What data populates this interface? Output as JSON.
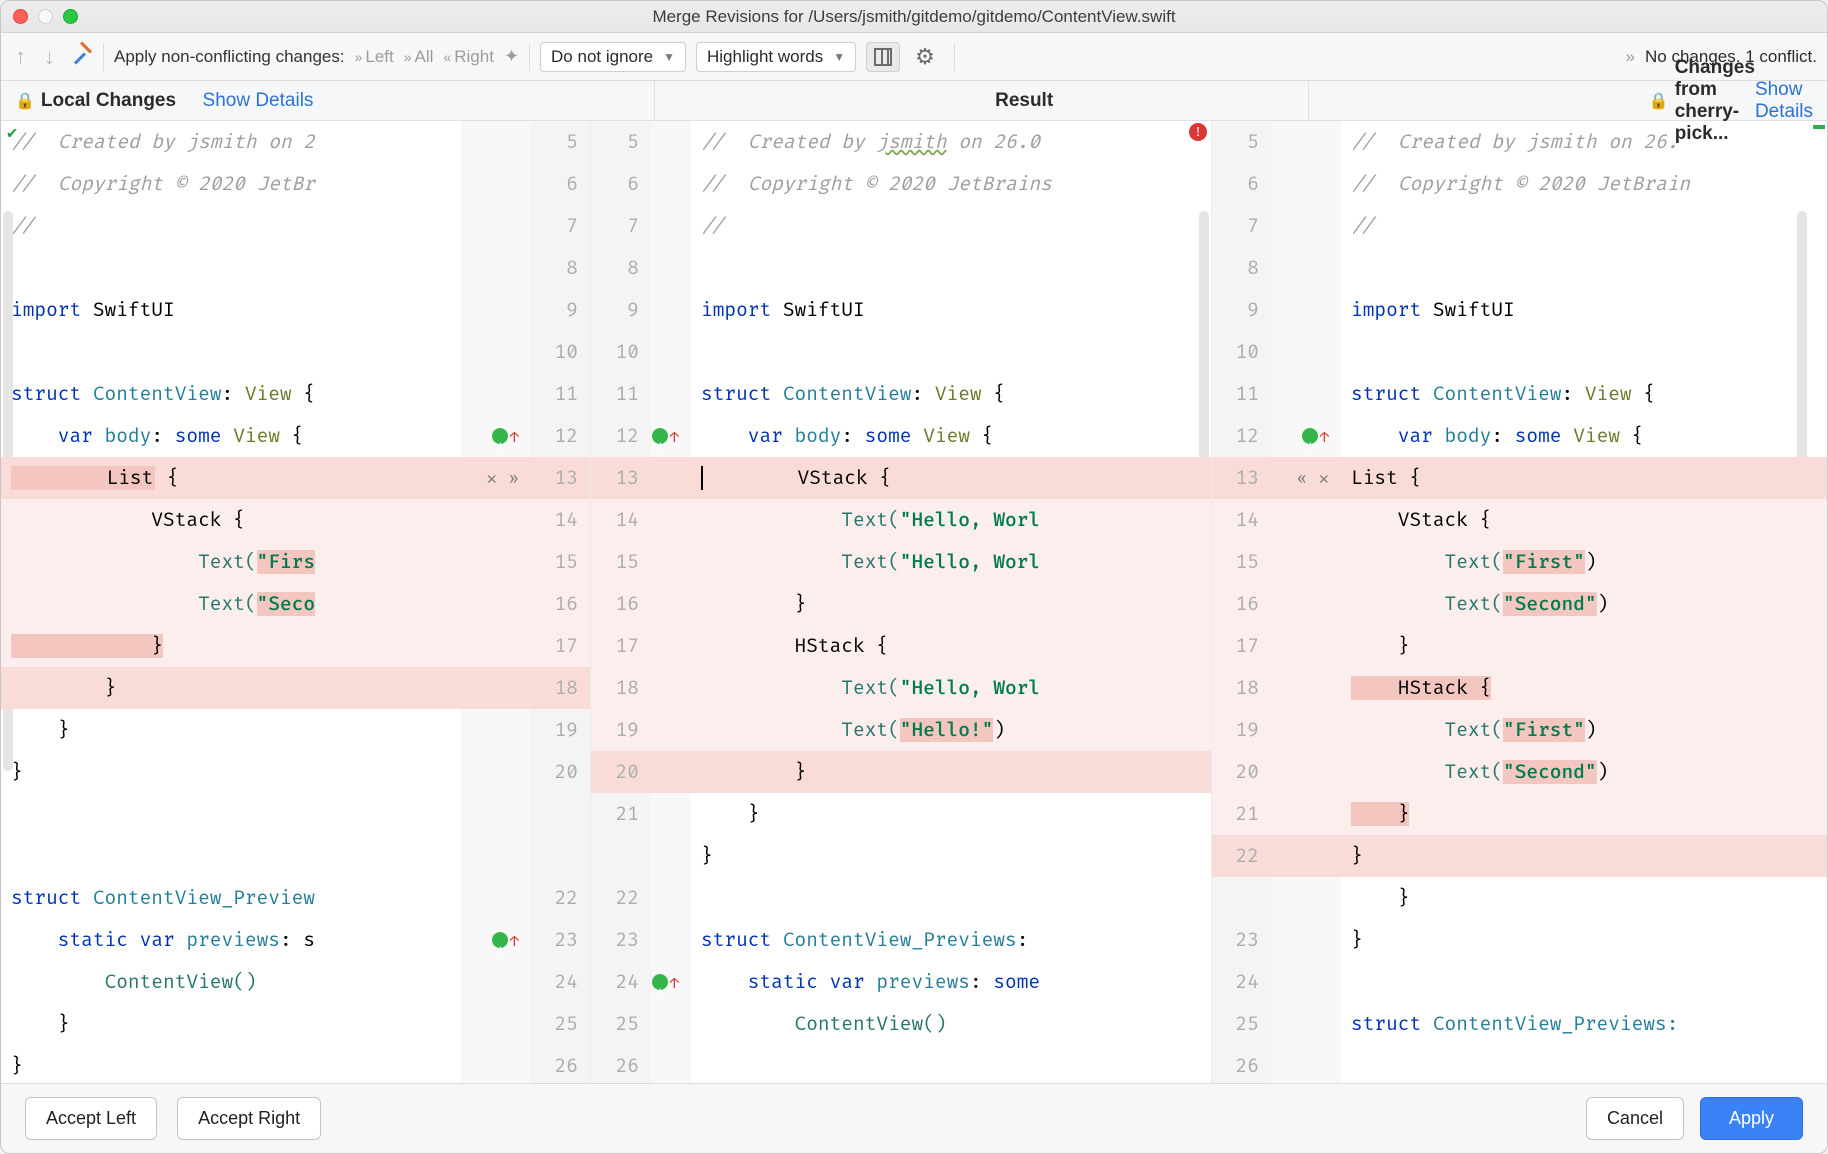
{
  "window_title": "Merge Revisions for /Users/jsmith/gitdemo/gitdemo/ContentView.swift",
  "toolbar": {
    "apply_label": "Apply non-conflicting changes:",
    "left": "Left",
    "all": "All",
    "right": "Right",
    "ignore_dropdown": "Do not ignore",
    "highlight_dropdown": "Highlight words",
    "status": "No changes. 1 conflict."
  },
  "headers": {
    "local": "Local Changes",
    "result": "Result",
    "remote": "Changes from cherry-pick...",
    "details": "Show Details"
  },
  "buttons": {
    "accept_left": "Accept Left",
    "accept_right": "Accept Right",
    "cancel": "Cancel",
    "apply": "Apply"
  },
  "gutters": {
    "left": [
      "5",
      "6",
      "7",
      "8",
      "9",
      "10",
      "11",
      "12",
      "13",
      "14",
      "15",
      "16",
      "17",
      "18",
      "19",
      "20",
      "",
      "",
      "22",
      "23",
      "24",
      "25",
      "26"
    ],
    "centerL": [
      "5",
      "6",
      "7",
      "8",
      "9",
      "10",
      "11",
      "12",
      "13",
      "14",
      "15",
      "16",
      "17",
      "18",
      "19",
      "20",
      "21",
      "",
      "22",
      "23",
      "24",
      "25",
      "26"
    ],
    "centerR": [
      "5",
      "6",
      "7",
      "8",
      "9",
      "10",
      "11",
      "12",
      "13",
      "14",
      "15",
      "16",
      "17",
      "18",
      "19",
      "20",
      "21",
      "22",
      "",
      "23",
      "24",
      "25",
      "26"
    ],
    "right": [
      "5",
      "6",
      "7",
      "8",
      "9",
      "10",
      "11",
      "12",
      "13",
      "14",
      "15",
      "16",
      "17",
      "18",
      "19",
      "20",
      "21",
      "22",
      "",
      "23",
      "24",
      "25",
      "26"
    ]
  },
  "left_code": {
    "l5": "//  Created by jsmith on 2",
    "l6": "//  Copyright © 2020 JetBr",
    "l7": "//",
    "l9a": "import",
    "l9b": " SwiftUI",
    "l11a": "struct",
    "l11b": " ContentView",
    "l11c": ": ",
    "l11d": "View",
    "l11e": " {",
    "l12a": "    var",
    "l12b": " body",
    "l12c": ": ",
    "l12d": "some",
    "l12e": " ",
    "l12f": "View",
    "l12g": " {",
    "l13": "        List {",
    "l14": "            VStack {",
    "l15a": "                Text(",
    "l15b": "\"Firs",
    "l16a": "                Text(",
    "l16b": "\"Seco",
    "l17": "            }",
    "l18": "        }",
    "l19": "    }",
    "l20": "}",
    "l22a": "struct",
    "l22b": " ContentView_Preview",
    "l23a": "    static",
    "l23b": " var",
    "l23c": " previews",
    "l23d": ": s",
    "l24": "        ContentView()",
    "l25": "    }",
    "l26": "}"
  },
  "mid_code": {
    "l5a": "//  Created by ",
    "l5b": "jsmith",
    "l5c": " on 26.0",
    "l6": "//  Copyright © 2020 JetBrains",
    "l7": "//",
    "l9a": "import",
    "l9b": " SwiftUI",
    "l11a": "struct",
    "l11b": " ContentView",
    "l11c": ": ",
    "l11d": "View",
    "l11e": " {",
    "l12a": "    var",
    "l12b": " body",
    "l12c": ": ",
    "l12d": "some",
    "l12e": " ",
    "l12f": "View",
    "l12g": " {",
    "l13": "        VStack {",
    "l14a": "            Text(",
    "l14b": "\"Hello, Worl",
    "l15a": "            Text(",
    "l15b": "\"Hello, Worl",
    "l16": "        }",
    "l17": "        HStack {",
    "l18a": "            Text(",
    "l18b": "\"Hello, Worl",
    "l19a": "            Text(",
    "l19b": "\"Hello!\"",
    "l19c": ")",
    "l20": "        }",
    "l21": "    }",
    "l22": "}",
    "l24a": "struct",
    "l24b": " ContentView_Previews",
    "l24c": ": ",
    "l25a": "    static",
    "l25b": " var",
    "l25c": " previews",
    "l25d": ": ",
    "l25e": "some",
    "l26": "        ContentView()"
  },
  "right_code": {
    "l5": "//  Created by jsmith on 26.",
    "l6": "//  Copyright © 2020 JetBrain",
    "l7": "//",
    "l9a": "import",
    "l9b": " SwiftUI",
    "l11a": "struct",
    "l11b": " ContentView",
    "l11c": ": ",
    "l11d": "View",
    "l11e": " {",
    "l12a": "    var",
    "l12b": " body",
    "l12c": ": ",
    "l12d": "some",
    "l12e": " ",
    "l12f": "View",
    "l12g": " {",
    "l13": "List {",
    "l14": "    VStack {",
    "l15a": "        Text(",
    "l15b": "\"First\"",
    "l15c": ")",
    "l16a": "        Text(",
    "l16b": "\"Second\"",
    "l16c": ")",
    "l17": "    }",
    "l18": "    HStack {",
    "l19a": "        Text(",
    "l19b": "\"First\"",
    "l19c": ")",
    "l20a": "        Text(",
    "l20b": "\"Second\"",
    "l20c": ")",
    "l21": "    }",
    "l22": "}",
    "l23": "    }",
    "l24": "}",
    "l26a": "struct",
    "l26b": " ContentView_Previews:"
  }
}
